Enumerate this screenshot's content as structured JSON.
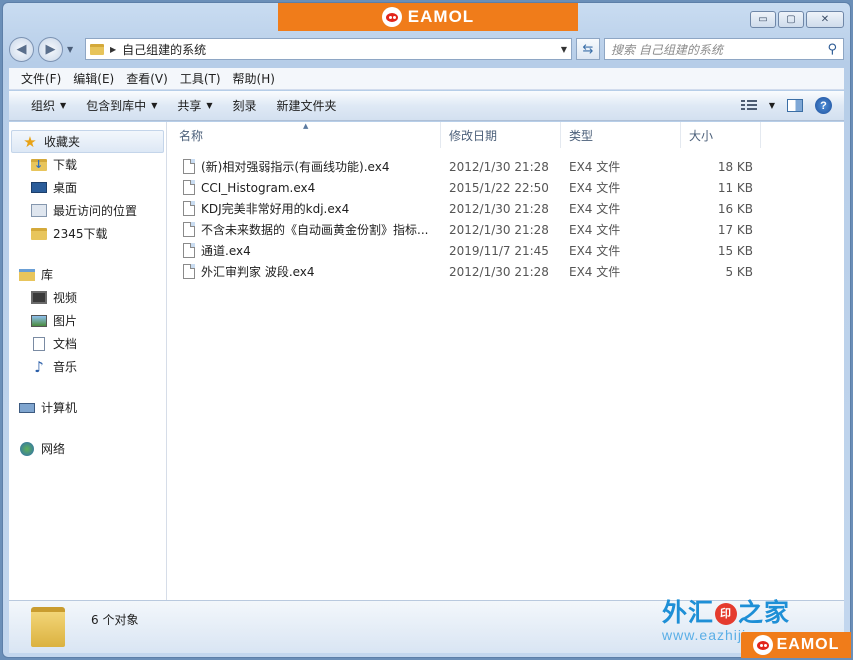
{
  "banner": {
    "brand": "EAMOL"
  },
  "window": {
    "caption": {
      "minimize": "▭",
      "maximize": "▢",
      "close": "✕"
    }
  },
  "address": {
    "path": "自己组建的系统",
    "search_placeholder": "搜索 自己组建的系统"
  },
  "menu": [
    "文件(F)",
    "编辑(E)",
    "查看(V)",
    "工具(T)",
    "帮助(H)"
  ],
  "commands": [
    {
      "label": "组织",
      "dropdown": true
    },
    {
      "label": "包含到库中",
      "dropdown": true
    },
    {
      "label": "共享",
      "dropdown": true
    },
    {
      "label": "刻录",
      "dropdown": false
    },
    {
      "label": "新建文件夹",
      "dropdown": false
    }
  ],
  "nav": {
    "favorites": {
      "label": "收藏夹",
      "items": [
        "下载",
        "桌面",
        "最近访问的位置",
        "2345下载"
      ]
    },
    "libraries": {
      "label": "库",
      "items": [
        "视频",
        "图片",
        "文档",
        "音乐"
      ]
    },
    "computer": "计算机",
    "network": "网络"
  },
  "columns": {
    "name": "名称",
    "date": "修改日期",
    "type": "类型",
    "size": "大小"
  },
  "files": [
    {
      "name": "(新)相对强弱指示(有画线功能).ex4",
      "date": "2012/1/30 21:28",
      "type": "EX4 文件",
      "size": "18 KB"
    },
    {
      "name": "CCI_Histogram.ex4",
      "date": "2015/1/22 22:50",
      "type": "EX4 文件",
      "size": "11 KB"
    },
    {
      "name": "KDJ完美非常好用的kdj.ex4",
      "date": "2012/1/30 21:28",
      "type": "EX4 文件",
      "size": "16 KB"
    },
    {
      "name": "不含未来数据的《自动画黄金份割》指标...",
      "date": "2012/1/30 21:28",
      "type": "EX4 文件",
      "size": "17 KB"
    },
    {
      "name": "通道.ex4",
      "date": "2019/11/7 21:45",
      "type": "EX4 文件",
      "size": "15 KB"
    },
    {
      "name": "外汇审判家 波段.ex4",
      "date": "2012/1/30 21:28",
      "type": "EX4 文件",
      "size": "5 KB"
    }
  ],
  "status": {
    "count": "6 个对象"
  },
  "watermark": {
    "title_a": "外汇",
    "seal": "印",
    "title_b": "之家",
    "url": "www.eazhijia.com"
  },
  "badge": {
    "brand": "EAMOL"
  },
  "colors": {
    "brand_orange": "#f07c1a",
    "watermark_blue": "#1e8fd6"
  }
}
